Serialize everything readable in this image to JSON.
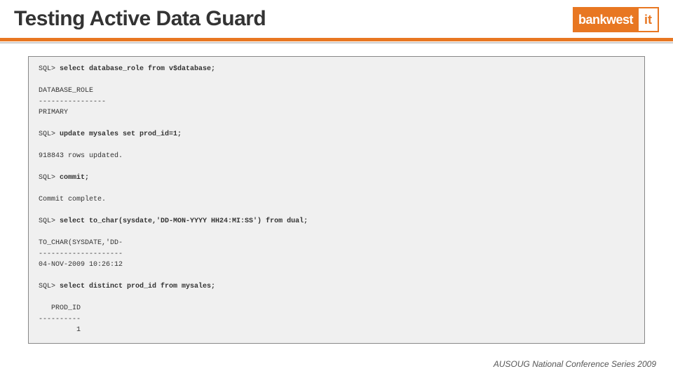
{
  "header": {
    "title": "Testing Active Data Guard",
    "logo_left": "bankwest",
    "logo_right": "it"
  },
  "code": {
    "prompt": "SQL> ",
    "lines": [
      {
        "t": "select database_role from v$database;",
        "b": true,
        "p": true
      },
      {
        "t": "",
        "b": false,
        "p": false
      },
      {
        "t": "DATABASE_ROLE",
        "b": false,
        "p": false
      },
      {
        "t": "----------------",
        "b": false,
        "p": false
      },
      {
        "t": "PRIMARY",
        "b": false,
        "p": false
      },
      {
        "t": "",
        "b": false,
        "p": false
      },
      {
        "t": "update mysales set prod_id=1;",
        "b": true,
        "p": true
      },
      {
        "t": "",
        "b": false,
        "p": false
      },
      {
        "t": "918843 rows updated.",
        "b": false,
        "p": false
      },
      {
        "t": "",
        "b": false,
        "p": false
      },
      {
        "t": "commit;",
        "b": true,
        "p": true
      },
      {
        "t": "",
        "b": false,
        "p": false
      },
      {
        "t": "Commit complete.",
        "b": false,
        "p": false
      },
      {
        "t": "",
        "b": false,
        "p": false
      },
      {
        "t": "select to_char(sysdate,'DD-MON-YYYY HH24:MI:SS') from dual;",
        "b": true,
        "p": true
      },
      {
        "t": "",
        "b": false,
        "p": false
      },
      {
        "t": "TO_CHAR(SYSDATE,'DD-",
        "b": false,
        "p": false
      },
      {
        "t": "--------------------",
        "b": false,
        "p": false
      },
      {
        "t": "04-NOV-2009 10:26:12",
        "b": false,
        "p": false
      },
      {
        "t": "",
        "b": false,
        "p": false
      },
      {
        "t": "select distinct prod_id from mysales;",
        "b": true,
        "p": true
      },
      {
        "t": "",
        "b": false,
        "p": false
      },
      {
        "t": "   PROD_ID",
        "b": false,
        "p": false
      },
      {
        "t": "----------",
        "b": false,
        "p": false
      },
      {
        "t": "         1",
        "b": false,
        "p": false
      }
    ]
  },
  "footer": {
    "text": "AUSOUG National Conference Series 2009"
  }
}
